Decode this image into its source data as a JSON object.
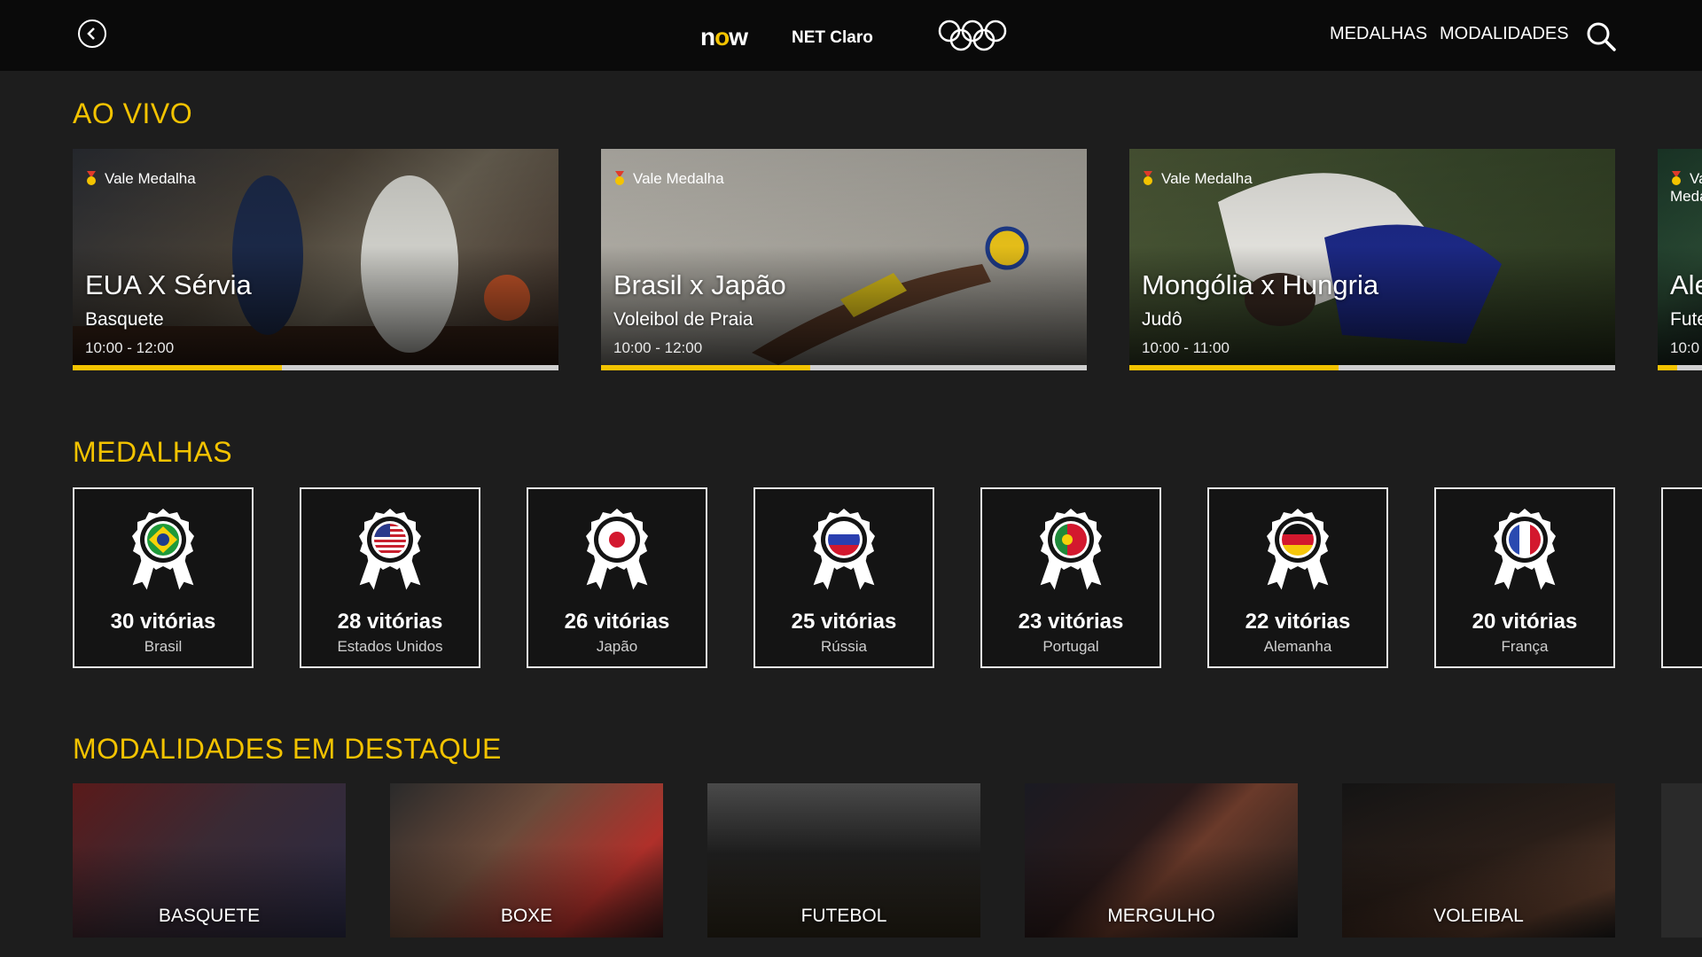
{
  "header": {
    "logo_now": "now",
    "logo_net_claro": "NET Claro",
    "nav": [
      "MEDALHAS",
      "MODALIDADES"
    ]
  },
  "sections": {
    "live_title": "AO VIVO",
    "medals_title": "MEDALHAS",
    "sports_title": "MODALIDADES EM DESTAQUE"
  },
  "live": [
    {
      "badge": "Vale Medalha",
      "title": "EUA X Sérvia",
      "sport": "Basquete",
      "time": "10:00 - 12:00",
      "progress": 0.43
    },
    {
      "badge": "Vale Medalha",
      "title": "Brasil x Japão",
      "sport": "Voleibol de Praia",
      "time": "10:00 - 12:00",
      "progress": 0.43
    },
    {
      "badge": "Vale Medalha",
      "title": "Mongólia x Hungria",
      "sport": "Judô",
      "time": "10:00 - 11:00",
      "progress": 0.43
    },
    {
      "badge": "Vale Medalha",
      "title": "Ale",
      "sport": "Fute",
      "time": "10:0",
      "progress": 0.43
    }
  ],
  "medals": [
    {
      "count": "30 vitórias",
      "country": "Brasil"
    },
    {
      "count": "28 vitórias",
      "country": "Estados Unidos"
    },
    {
      "count": "26 vitórias",
      "country": "Japão"
    },
    {
      "count": "25 vitórias",
      "country": "Rússia"
    },
    {
      "count": "23 vitórias",
      "country": "Portugal"
    },
    {
      "count": "22 vitórias",
      "country": "Alemanha"
    },
    {
      "count": "20 vitórias",
      "country": "França"
    }
  ],
  "sports": [
    "BASQUETE",
    "BOXE",
    "FUTEBOL",
    "MERGULHO",
    "VOLEIBAL"
  ],
  "colors": {
    "accent": "#f3c300",
    "background": "#1d1d1d",
    "topbar": "#0a0a0a"
  }
}
